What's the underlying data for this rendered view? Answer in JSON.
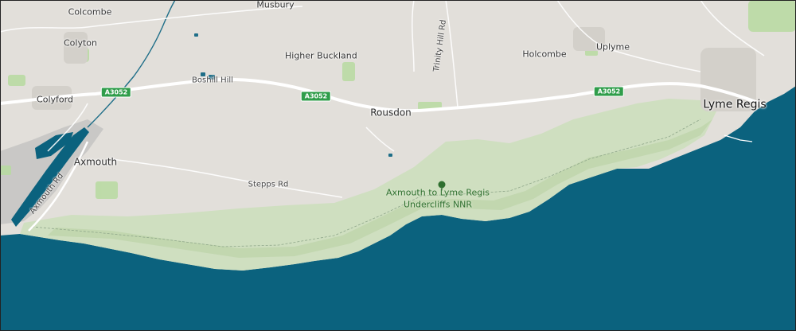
{
  "map": {
    "colors": {
      "land": "#e2dfda",
      "sea": "#0b627e",
      "cliff_green": "#cfdfc0",
      "cliff_green_dark": "#bcd3a8",
      "park_green": "#b7dba0",
      "urban": "#d6d3cd",
      "road": "#ffffff",
      "shield": "#2f9d4a",
      "water": "#1e6e88",
      "nnr_text": "#2f6f2f"
    },
    "places": {
      "colcombe": "Colcombe",
      "musbury": "Musbury",
      "colyton": "Colyton",
      "higher_buckland": "Higher Buckland",
      "holcombe": "Holcombe",
      "uplyme": "Uplyme",
      "colyford": "Colyford",
      "rousdon": "Rousdon",
      "lyme_regis": "Lyme Regis",
      "axmouth": "Axmouth"
    },
    "roads": {
      "trinity_hill_rd": "Trinity Hill Rd",
      "boshill_hill": "Boshill Hill",
      "stepps_rd": "Stepps Rd",
      "axmouth_rd": "Axmouth Rd"
    },
    "road_shields": [
      "A3052",
      "A3052",
      "A3052"
    ],
    "nature_reserve": {
      "icon": "tree-icon",
      "line1": "Axmouth to Lyme Regis",
      "line2": "Undercliffs NNR"
    }
  }
}
